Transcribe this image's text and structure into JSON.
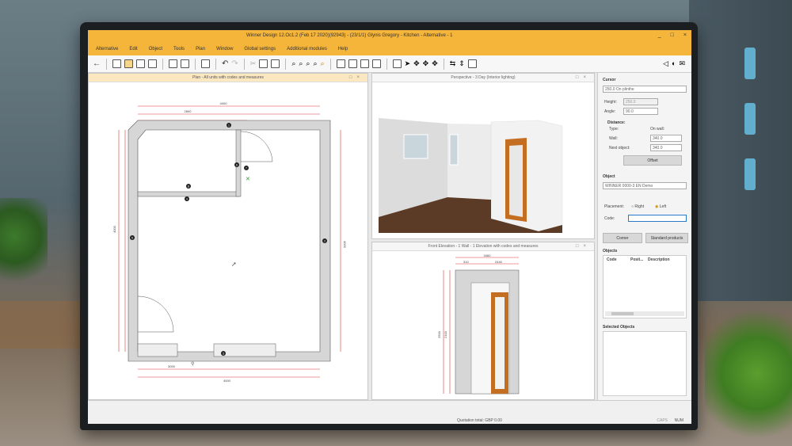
{
  "window": {
    "title": "Winner Design 12.Oc1.2  (Feb 17 2020)(92943)  - (23/1/1) Glynis Gregory - Kitchen - Alternative - 1",
    "min": "_",
    "max": "□",
    "close": "×"
  },
  "menu": [
    "Alternative",
    "Edit",
    "Object",
    "Tools",
    "Plan",
    "Window",
    "Global settings",
    "Additional modules",
    "Help"
  ],
  "panels": {
    "plan_title": "Plan - All units with codes and measures",
    "perspective_title": "Perspective - 3 Day (Interior lighting)",
    "front_title": "Front Elevation - 1 Wall - 1 Elevation with codes and measures"
  },
  "plan": {
    "dims_top": [
      "4000",
      "2800"
    ],
    "dims_bottom": [
      "3000",
      "4000"
    ],
    "dims_left": [
      "4000",
      "2800"
    ],
    "dims_right": [
      "4000"
    ],
    "codes": [
      "1",
      "2",
      "3",
      "4",
      "5",
      "6",
      "7",
      "8"
    ]
  },
  "front": {
    "dims_top": [
      "3460",
      "310",
      "2440"
    ],
    "dims_left": [
      "2500",
      "2100"
    ]
  },
  "side": {
    "cursor_title": "Cursor",
    "cursor_select": "250.0  On plinthe",
    "height_label": "Height:",
    "height_value": "250.0",
    "angle_label": "Angle:",
    "angle_value": "90.0",
    "distance_title": "Distance:",
    "type_label": "Type:",
    "on_wall_label": "On wall:",
    "wall_label": "Wall:",
    "wall_value": "340.0",
    "next_object_label": "Next object:",
    "next_object_value": "340.0",
    "offset_button": "Offset",
    "object_title": "Object",
    "object_select": "WINNER 0000-3 EN Demo",
    "placement_label": "Placement:",
    "right_label": "Right",
    "left_label": "Left",
    "code_label": "Code:",
    "corner_button": "Corner",
    "standard_products_button": "Standard products",
    "objects_title": "Objects",
    "col_code": "Code",
    "col_pos": "Posit...",
    "col_desc": "Description",
    "selected_objects_title": "Selected Objects"
  },
  "status": {
    "quotation": "Quotation total: GBP 0.00",
    "caps": "CAPS",
    "num": "NUM"
  },
  "colors": {
    "titlebar": "#f5b43a",
    "wall_gray": "#d6d6d6",
    "dim_red": "#d33333",
    "floor_wood": "#5b3a26",
    "door_wood": "#c46e22"
  }
}
